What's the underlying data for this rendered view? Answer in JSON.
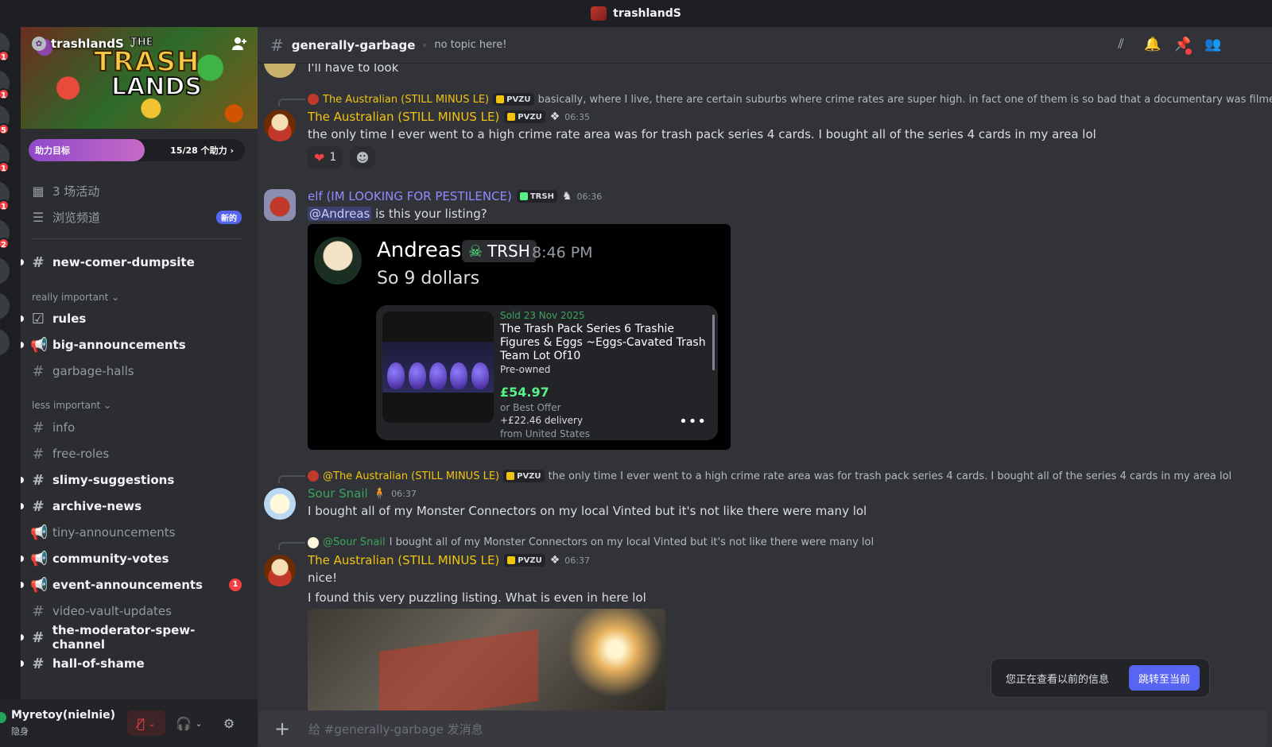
{
  "window": {
    "title": "trashlandS"
  },
  "rail": {
    "badges": [
      "1",
      "1",
      "5",
      "1",
      "1",
      "2"
    ]
  },
  "server": {
    "name": "trashlandS",
    "banner_logo": [
      "THE",
      "TRASH",
      "LANDS"
    ],
    "boost": {
      "label": "助力目标",
      "count": "15/28 个助力 ›",
      "progress": 0.536
    }
  },
  "sidebar": {
    "events": "3 场活动",
    "browse": "浏览频道",
    "new_badge": "新的",
    "categories": {
      "important": "really important ⌄",
      "less": "less important ⌄"
    },
    "channels": [
      {
        "name": "new-comer-dumpsite",
        "icon": "#",
        "unread": true
      },
      {
        "name": "rules",
        "icon": "☑",
        "unread": true
      },
      {
        "name": "big-announcements",
        "icon": "📢",
        "unread": true
      },
      {
        "name": "garbage-halls",
        "icon": "#",
        "unread": false
      },
      {
        "name": "info",
        "icon": "#",
        "unread": false
      },
      {
        "name": "free-roles",
        "icon": "#",
        "unread": false
      },
      {
        "name": "slimy-suggestions",
        "icon": "#",
        "unread": true
      },
      {
        "name": "archive-news",
        "icon": "#",
        "unread": true
      },
      {
        "name": "tiny-announcements",
        "icon": "📢",
        "unread": false
      },
      {
        "name": "community-votes",
        "icon": "📢",
        "unread": true
      },
      {
        "name": "event-announcements",
        "icon": "📢",
        "unread": true,
        "badge": "1"
      },
      {
        "name": "video-vault-updates",
        "icon": "#",
        "unread": false
      },
      {
        "name": "the-moderator-spew-channel",
        "icon": "#",
        "unread": true
      },
      {
        "name": "hall-of-shame",
        "icon": "#",
        "unread": true
      }
    ]
  },
  "user": {
    "name": "Myretoy(nielnie)",
    "status": "隐身"
  },
  "channel": {
    "name": "generally-garbage",
    "topic": "no topic here!"
  },
  "messages": {
    "m0": {
      "text": "I'll have to look"
    },
    "m1": {
      "reply_author": "The Australian (STILL MINUS LE)",
      "reply_tag": "PVZU",
      "reply_text": "basically, where I live, there are certain suburbs where crime rates are super high. in fact one of them is so bad that a documentary was filmed about it",
      "author": "The Australian (STILL MINUS LE)",
      "tag": "PVZU",
      "time": "06:35",
      "text": "the only time I ever went to a high crime rate area was for trash pack series 4 cards. I bought all of the series 4 cards in my area lol",
      "reaction_count": "1"
    },
    "m2": {
      "author": "elf (IM LOOKING FOR PESTILENCE)",
      "tag": "TRSH",
      "time": "06:36",
      "mention": "@Andreas",
      "text": " is this your listing?",
      "embed": {
        "name": "Andreas",
        "tag": "TRSH",
        "time": "8:46 PM",
        "message": "So 9 dollars",
        "listing": {
          "sold": "Sold  23 Nov 2025",
          "title": "The Trash Pack Series 6 Trashie Figures & Eggs ~Eggs-Cavated Trash Team Lot Of10",
          "condition": "Pre-owned",
          "price": "£54.97",
          "offer": "or Best Offer",
          "delivery": "+£22.46 delivery",
          "from": "from United States",
          "more": "•••"
        }
      }
    },
    "m3": {
      "reply_author": "@The Australian (STILL MINUS LE)",
      "reply_tag": "PVZU",
      "reply_text": "the only time I ever went to a high crime rate area was for trash pack series 4 cards. I bought all of the series 4 cards in my area lol",
      "author": "Sour Snail",
      "time": "06:37",
      "text": "I bought all of my Monster Connectors on my local Vinted but it's not like there were many lol"
    },
    "m4": {
      "reply_author": "@Sour Snail",
      "reply_text": "I bought all of my Monster Connectors on my local Vinted but it's not like there were many lol",
      "author": "The Australian (STILL MINUS LE)",
      "tag": "PVZU",
      "time": "06:37",
      "text1": "nice!",
      "text2": "I found this very puzzling listing. What is even in here lol"
    }
  },
  "jump": {
    "text": "您正在查看以前的信息",
    "button": "跳转至当前"
  },
  "composer": {
    "placeholder": "给 #generally-garbage 发消息"
  },
  "colors": {
    "accent": "#5865f2",
    "gold_name": "#f1c40f",
    "purple_name": "#8f8cff",
    "green_name": "#3ba55d"
  }
}
